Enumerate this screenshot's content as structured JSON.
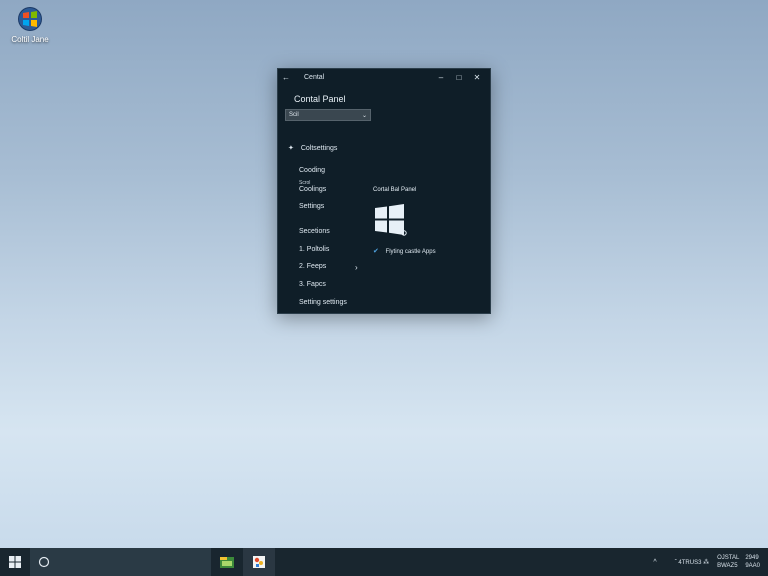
{
  "desktop": {
    "icon_label": "Coltil Jane"
  },
  "window": {
    "title": "Cental",
    "back_glyph": "←",
    "minimize_glyph": "–",
    "maximize_glyph": "□",
    "close_glyph": "✕",
    "heading": "Contal Panel",
    "search_value": "Scil",
    "search_chevron": "⌄",
    "nav_title": "Coltsettings",
    "nav_star": "✦",
    "nav_items": [
      {
        "label": "Cooding"
      },
      {
        "label": "Scrol"
      },
      {
        "label": "Coolings"
      },
      {
        "label": "Settings"
      },
      {
        "label": "Secetions"
      },
      {
        "label": "1. Poltolis"
      },
      {
        "label": "2. Feeps"
      },
      {
        "label": "3. Fapcs"
      },
      {
        "label": "Setting settings"
      }
    ],
    "nav_chevron": "›",
    "content_title": "Cortal Bal Panel",
    "check_label": "Flyting castle Apps",
    "check_glyph": "✔"
  },
  "taskbar": {
    "up_glyph": "^",
    "sys_text": "ˆ  4TRUS3  ⁂",
    "clock_line1": "OJSTAL",
    "clock_line2": "BWAZ5",
    "time_line1": "2949",
    "time_line2": "9AA0"
  },
  "colors": {
    "window_bg": "#0f1e28",
    "accent": "#4fa3e0",
    "taskbar_bg": "#19262f"
  },
  "icons": {
    "start": "windows-start-icon",
    "search": "cortana-ring-icon",
    "app1": "file-explorer-icon",
    "app2": "paint-app-icon"
  }
}
